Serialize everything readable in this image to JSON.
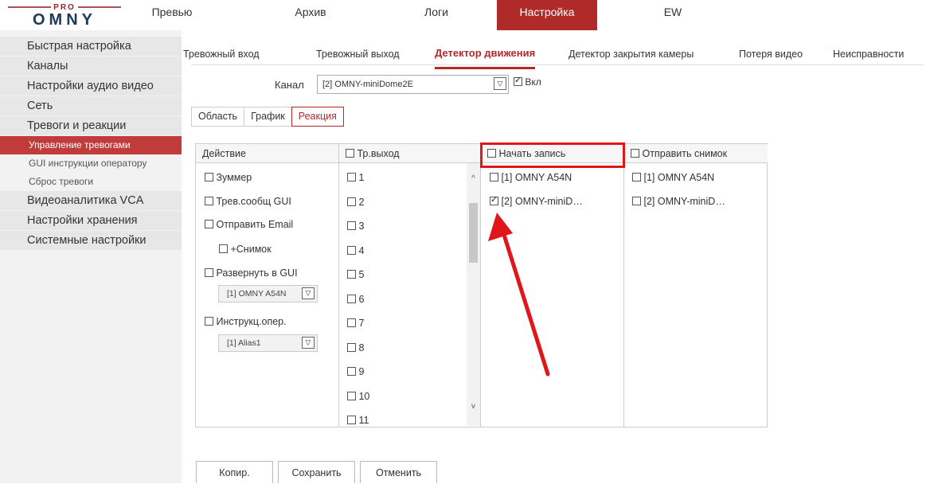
{
  "brand": {
    "top": "PRO",
    "name": "OMNY"
  },
  "nav": [
    {
      "label": "Превью"
    },
    {
      "label": "Архив"
    },
    {
      "label": "Логи"
    },
    {
      "label": "Настройка"
    },
    {
      "label": "EW"
    }
  ],
  "sidebar": {
    "items": [
      {
        "label": "Быстрая настройка"
      },
      {
        "label": "Каналы"
      },
      {
        "label": "Настройки аудио видео"
      },
      {
        "label": "Сеть"
      },
      {
        "label": "Тревоги и реакции"
      }
    ],
    "sub": [
      {
        "label": "Управление тревогами"
      },
      {
        "label": "GUI инструкции оператору"
      },
      {
        "label": "Сброс тревоги"
      }
    ],
    "items2": [
      {
        "label": "Видеоаналитика VCA"
      },
      {
        "label": "Настройки хранения"
      },
      {
        "label": "Системные настройки"
      }
    ]
  },
  "tabs": [
    {
      "label": "Тревожный вход"
    },
    {
      "label": "Тревожный выход"
    },
    {
      "label": "Детектор движения"
    },
    {
      "label": "Детектор закрытия камеры"
    },
    {
      "label": "Потеря видео"
    },
    {
      "label": "Неисправности"
    }
  ],
  "channel": {
    "label": "Канал",
    "value": "[2] OMNY-miniDome2E",
    "enable_label": "Вкл",
    "enabled": true
  },
  "crumbs": [
    {
      "label": "Область"
    },
    {
      "label": "График"
    },
    {
      "label": "Реакция"
    }
  ],
  "table": {
    "headers": {
      "action": "Действие",
      "alarm_out": "Тр.выход",
      "record": "Начать запись",
      "snapshot": "Отправить снимок"
    },
    "actions": {
      "buzzer": "Зуммер",
      "gui_msg": "Трев.сообщ GUI",
      "email": "Отправить Email",
      "snapshot": "+Снимок",
      "expand": "Развернуть в GUI",
      "expand_value": "[1] OMNY A54N",
      "instr": "Инструкц.опер.",
      "instr_value": "[1] Alias1"
    },
    "alarm_outputs": [
      "1",
      "2",
      "3",
      "4",
      "5",
      "6",
      "7",
      "8",
      "9",
      "10",
      "11"
    ],
    "record": [
      {
        "label": "[1] OMNY A54N",
        "checked": false
      },
      {
        "label": "[2] OMNY-miniD…",
        "checked": true
      }
    ],
    "snap": [
      {
        "label": "[1] OMNY A54N"
      },
      {
        "label": "[2] OMNY-miniD…"
      }
    ]
  },
  "buttons": {
    "copy": "Копир.",
    "save": "Сохранить",
    "cancel": "Отменить"
  },
  "colors": {
    "accent": "#b02a2a",
    "highlight": "#e0161a"
  }
}
